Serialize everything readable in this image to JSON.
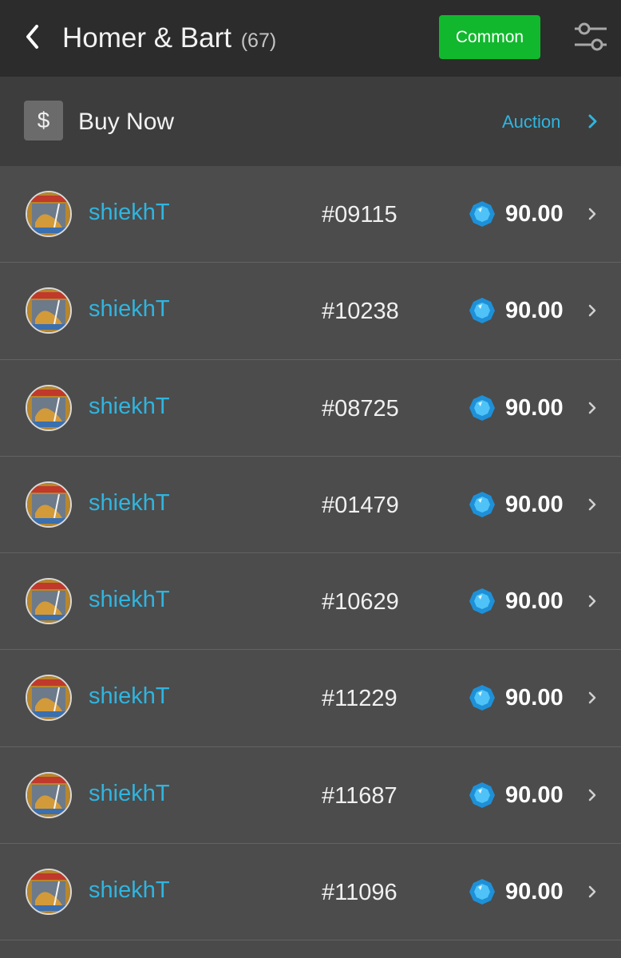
{
  "header": {
    "title": "Homer & Bart",
    "count": "(67)",
    "rarity_button": "Common",
    "back_icon": "chevron-left-icon",
    "filter_icon": "sliders-icon"
  },
  "subbar": {
    "currency_symbol": "$",
    "buy_now_label": "Buy Now",
    "auction_label": "Auction"
  },
  "colors": {
    "accent_blue": "#2fb5e0",
    "button_green": "#11b82d",
    "header_bg": "#2c2c2c",
    "row_bg": "#4c4c4c"
  },
  "listings": [
    {
      "seller": "shiekhT",
      "serial": "#09115",
      "price": "90.00"
    },
    {
      "seller": "shiekhT",
      "serial": "#10238",
      "price": "90.00"
    },
    {
      "seller": "shiekhT",
      "serial": "#08725",
      "price": "90.00"
    },
    {
      "seller": "shiekhT",
      "serial": "#01479",
      "price": "90.00"
    },
    {
      "seller": "shiekhT",
      "serial": "#10629",
      "price": "90.00"
    },
    {
      "seller": "shiekhT",
      "serial": "#11229",
      "price": "90.00"
    },
    {
      "seller": "shiekhT",
      "serial": "#11687",
      "price": "90.00"
    },
    {
      "seller": "shiekhT",
      "serial": "#11096",
      "price": "90.00"
    }
  ]
}
